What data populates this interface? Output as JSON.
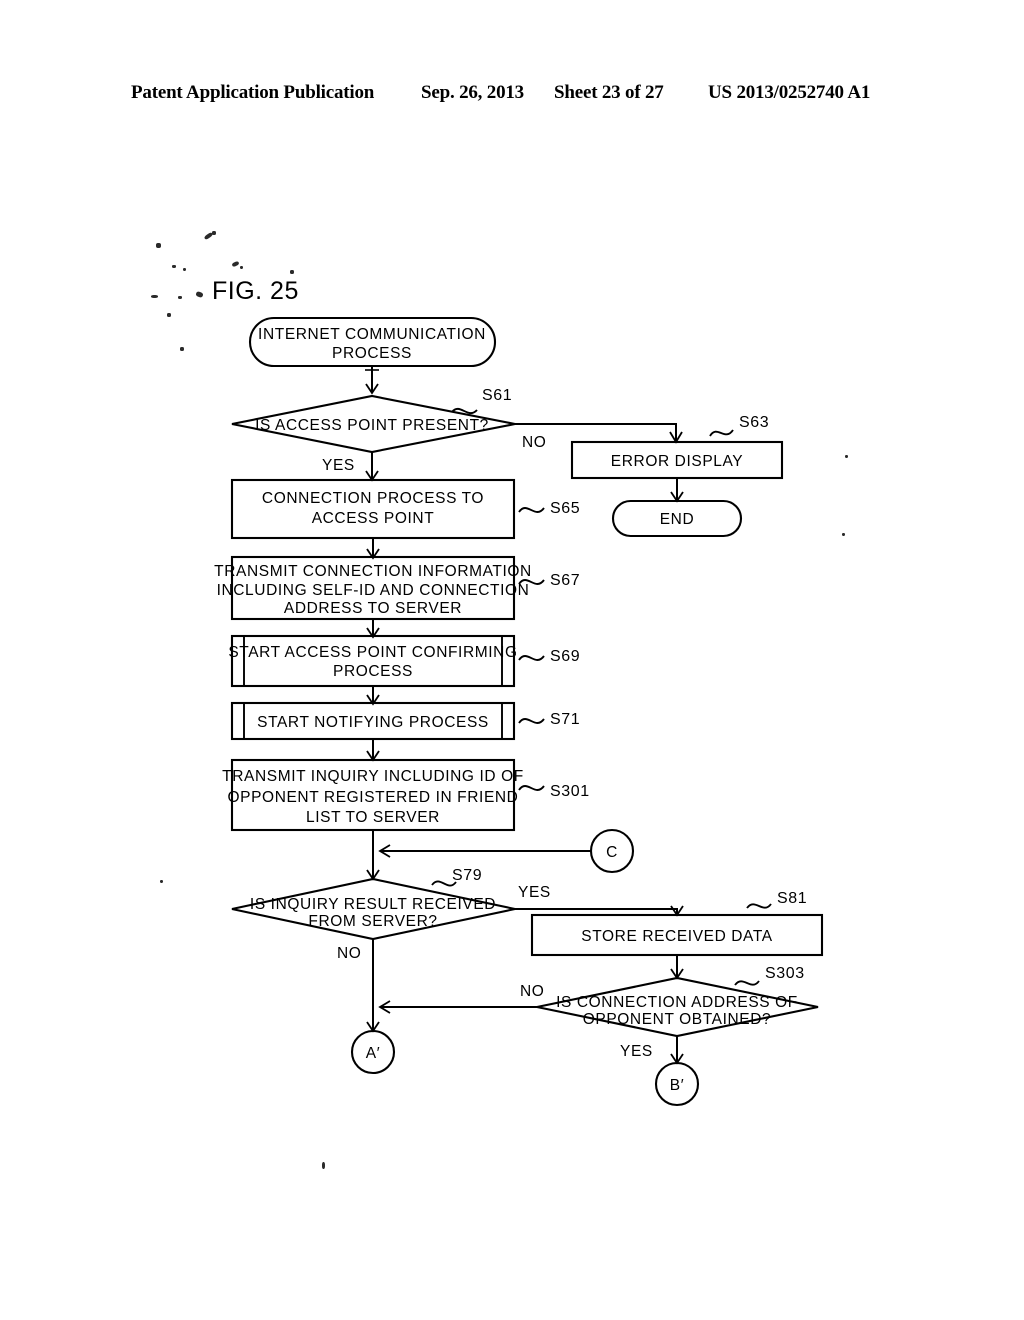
{
  "header": {
    "publication": "Patent Application Publication",
    "date": "Sep. 26, 2013",
    "sheet": "Sheet 23 of 27",
    "patent_number": "US 2013/0252740 A1"
  },
  "figure": {
    "label": "FIG. 25"
  },
  "flowchart": {
    "start": {
      "id": "start-terminal",
      "line1": "INTERNET COMMUNICATION",
      "line2": "PROCESS"
    },
    "end": {
      "id": "end-terminal",
      "label": "END"
    },
    "nodes": [
      {
        "id": "s61",
        "step": "S61",
        "type": "decision",
        "lines": [
          "IS ACCESS POINT PRESENT?"
        ],
        "yes": "YES",
        "no": "NO"
      },
      {
        "id": "s63",
        "step": "S63",
        "type": "process",
        "lines": [
          "ERROR DISPLAY"
        ]
      },
      {
        "id": "s65",
        "step": "S65",
        "type": "process",
        "lines": [
          "CONNECTION PROCESS TO",
          "ACCESS POINT"
        ]
      },
      {
        "id": "s67",
        "step": "S67",
        "type": "process",
        "lines": [
          "TRANSMIT CONNECTION INFORMATION",
          "INCLUDING SELF-ID AND CONNECTION",
          "ADDRESS TO SERVER"
        ]
      },
      {
        "id": "s69",
        "step": "S69",
        "type": "predefined-process",
        "lines": [
          "START ACCESS POINT CONFIRMING",
          "PROCESS"
        ]
      },
      {
        "id": "s71",
        "step": "S71",
        "type": "predefined-process",
        "lines": [
          "START NOTIFYING PROCESS"
        ]
      },
      {
        "id": "s301",
        "step": "S301",
        "type": "process",
        "lines": [
          "TRANSMIT INQUIRY INCLUDING ID OF",
          "OPPONENT REGISTERED IN FRIEND",
          "LIST TO SERVER"
        ]
      },
      {
        "id": "s79",
        "step": "S79",
        "type": "decision",
        "lines": [
          "IS INQUIRY RESULT RECEIVED",
          "FROM SERVER?"
        ],
        "yes": "YES",
        "no": "NO"
      },
      {
        "id": "s81",
        "step": "S81",
        "type": "process",
        "lines": [
          "STORE RECEIVED DATA"
        ]
      },
      {
        "id": "s303",
        "step": "S303",
        "type": "decision",
        "lines": [
          "IS CONNECTION ADDRESS OF",
          "OPPONENT OBTAINED?"
        ],
        "yes": "YES",
        "no": "NO"
      }
    ],
    "connectors": [
      {
        "id": "conn-c",
        "label": "C"
      },
      {
        "id": "conn-a-prime",
        "label": "A′"
      },
      {
        "id": "conn-b-prime",
        "label": "B′"
      }
    ]
  }
}
